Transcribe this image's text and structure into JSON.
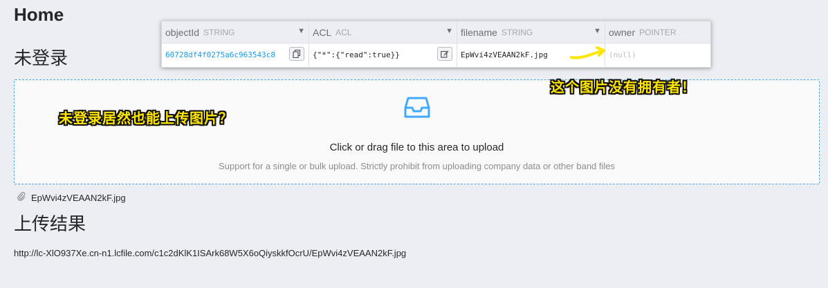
{
  "page": {
    "heading": "Home",
    "login_status": "未登录",
    "result_heading": "上传结果",
    "result_url": "http://lc-XlO937Xe.cn-n1.lcfile.com/c1c2dKlK1ISArk68W5X6oQiyskkfOcrU/EpWvi4zVEAAN2kF.jpg"
  },
  "data_browser": {
    "columns": [
      {
        "name": "objectId",
        "type": "STRING"
      },
      {
        "name": "ACL",
        "type": "ACL"
      },
      {
        "name": "filename",
        "type": "STRING"
      },
      {
        "name": "owner",
        "type": "POINTER"
      }
    ],
    "row": {
      "objectId": "60728df4f0275a6c963543c8",
      "acl": "{\"*\":{\"read\":true}}",
      "filename": "EpWvi4zVEAAN2kF.jpg",
      "owner": "(null)"
    },
    "menu_glyph": "▼"
  },
  "upload": {
    "text": "Click or drag file to this area to upload",
    "hint": "Support for a single or bulk upload. Strictly prohibit from uploading company data or other band files",
    "accent": "#4aa3e0"
  },
  "file_list": [
    {
      "name": "EpWvi4zVEAAN2kF.jpg",
      "icon": "paperclip-icon"
    }
  ],
  "annotations": {
    "left": "未登录居然也能上传图片？",
    "right": "这个图片没有拥有者！",
    "color": "#ffe600"
  }
}
